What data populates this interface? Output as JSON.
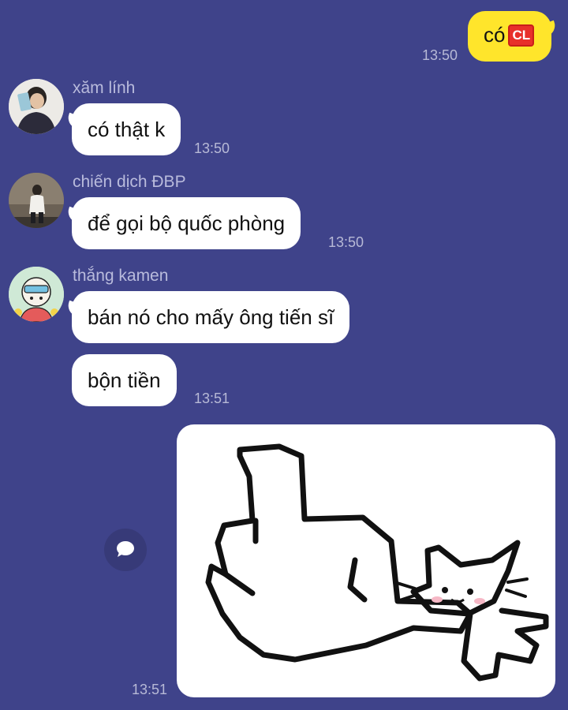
{
  "messages": {
    "outgoing_1": {
      "text": "có",
      "badge": "CL",
      "time": "13:50"
    },
    "xam_linh": {
      "sender": "xăm lính",
      "text": "có thật k",
      "time": "13:50"
    },
    "chien_dich": {
      "sender": "chiến dịch ĐBP",
      "text": "để gọi bộ quốc phòng",
      "time": "13:50"
    },
    "thang_kamen": {
      "sender": "thắng kamen",
      "text_1": "bán nó cho mấy ông tiến sĩ",
      "text_2": "bộn tiền",
      "time": "13:51"
    },
    "sticker": {
      "time": "13:51",
      "icon": "middle-finger-cat-sticker"
    }
  },
  "colors": {
    "background": "#3f438a",
    "incoming_bubble": "#ffffff",
    "outgoing_bubble": "#ffe52b",
    "badge": "#e8302a"
  },
  "icons": {
    "floating_button": "chat-bubble-icon"
  }
}
